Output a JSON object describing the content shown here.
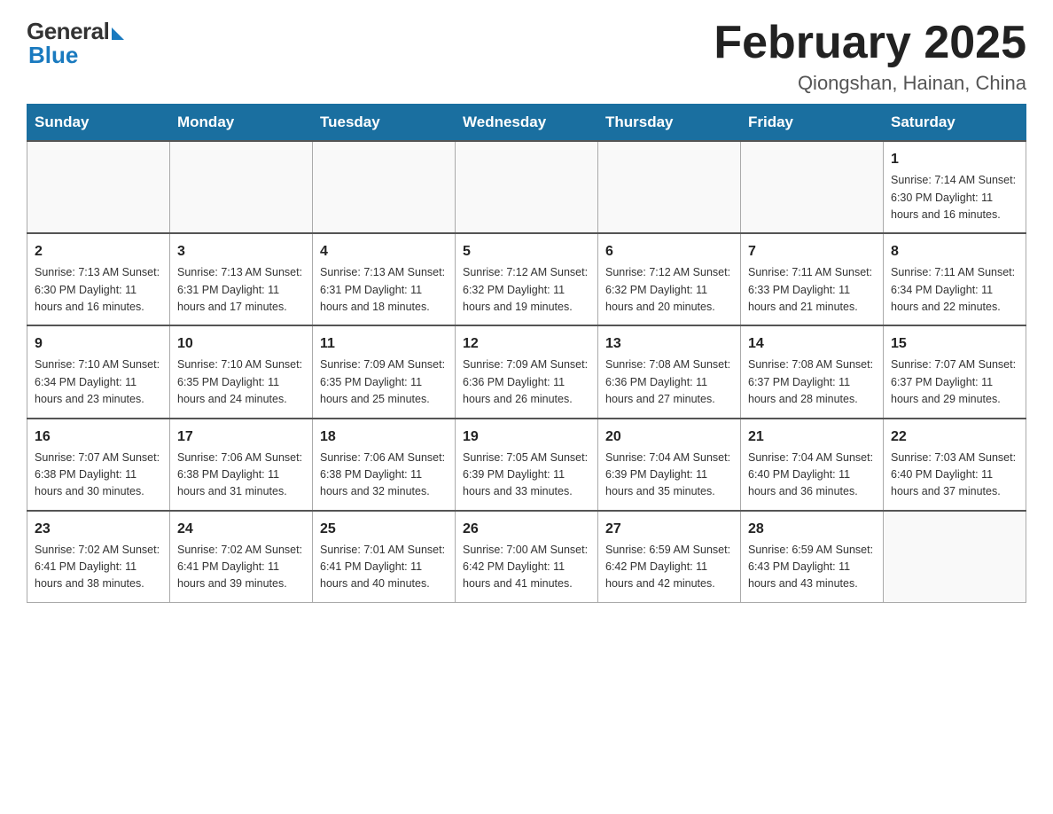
{
  "header": {
    "logo_general": "General",
    "logo_blue": "Blue",
    "month_title": "February 2025",
    "location": "Qiongshan, Hainan, China"
  },
  "weekdays": [
    "Sunday",
    "Monday",
    "Tuesday",
    "Wednesday",
    "Thursday",
    "Friday",
    "Saturday"
  ],
  "weeks": [
    [
      {
        "day": "",
        "info": ""
      },
      {
        "day": "",
        "info": ""
      },
      {
        "day": "",
        "info": ""
      },
      {
        "day": "",
        "info": ""
      },
      {
        "day": "",
        "info": ""
      },
      {
        "day": "",
        "info": ""
      },
      {
        "day": "1",
        "info": "Sunrise: 7:14 AM\nSunset: 6:30 PM\nDaylight: 11 hours\nand 16 minutes."
      }
    ],
    [
      {
        "day": "2",
        "info": "Sunrise: 7:13 AM\nSunset: 6:30 PM\nDaylight: 11 hours\nand 16 minutes."
      },
      {
        "day": "3",
        "info": "Sunrise: 7:13 AM\nSunset: 6:31 PM\nDaylight: 11 hours\nand 17 minutes."
      },
      {
        "day": "4",
        "info": "Sunrise: 7:13 AM\nSunset: 6:31 PM\nDaylight: 11 hours\nand 18 minutes."
      },
      {
        "day": "5",
        "info": "Sunrise: 7:12 AM\nSunset: 6:32 PM\nDaylight: 11 hours\nand 19 minutes."
      },
      {
        "day": "6",
        "info": "Sunrise: 7:12 AM\nSunset: 6:32 PM\nDaylight: 11 hours\nand 20 minutes."
      },
      {
        "day": "7",
        "info": "Sunrise: 7:11 AM\nSunset: 6:33 PM\nDaylight: 11 hours\nand 21 minutes."
      },
      {
        "day": "8",
        "info": "Sunrise: 7:11 AM\nSunset: 6:34 PM\nDaylight: 11 hours\nand 22 minutes."
      }
    ],
    [
      {
        "day": "9",
        "info": "Sunrise: 7:10 AM\nSunset: 6:34 PM\nDaylight: 11 hours\nand 23 minutes."
      },
      {
        "day": "10",
        "info": "Sunrise: 7:10 AM\nSunset: 6:35 PM\nDaylight: 11 hours\nand 24 minutes."
      },
      {
        "day": "11",
        "info": "Sunrise: 7:09 AM\nSunset: 6:35 PM\nDaylight: 11 hours\nand 25 minutes."
      },
      {
        "day": "12",
        "info": "Sunrise: 7:09 AM\nSunset: 6:36 PM\nDaylight: 11 hours\nand 26 minutes."
      },
      {
        "day": "13",
        "info": "Sunrise: 7:08 AM\nSunset: 6:36 PM\nDaylight: 11 hours\nand 27 minutes."
      },
      {
        "day": "14",
        "info": "Sunrise: 7:08 AM\nSunset: 6:37 PM\nDaylight: 11 hours\nand 28 minutes."
      },
      {
        "day": "15",
        "info": "Sunrise: 7:07 AM\nSunset: 6:37 PM\nDaylight: 11 hours\nand 29 minutes."
      }
    ],
    [
      {
        "day": "16",
        "info": "Sunrise: 7:07 AM\nSunset: 6:38 PM\nDaylight: 11 hours\nand 30 minutes."
      },
      {
        "day": "17",
        "info": "Sunrise: 7:06 AM\nSunset: 6:38 PM\nDaylight: 11 hours\nand 31 minutes."
      },
      {
        "day": "18",
        "info": "Sunrise: 7:06 AM\nSunset: 6:38 PM\nDaylight: 11 hours\nand 32 minutes."
      },
      {
        "day": "19",
        "info": "Sunrise: 7:05 AM\nSunset: 6:39 PM\nDaylight: 11 hours\nand 33 minutes."
      },
      {
        "day": "20",
        "info": "Sunrise: 7:04 AM\nSunset: 6:39 PM\nDaylight: 11 hours\nand 35 minutes."
      },
      {
        "day": "21",
        "info": "Sunrise: 7:04 AM\nSunset: 6:40 PM\nDaylight: 11 hours\nand 36 minutes."
      },
      {
        "day": "22",
        "info": "Sunrise: 7:03 AM\nSunset: 6:40 PM\nDaylight: 11 hours\nand 37 minutes."
      }
    ],
    [
      {
        "day": "23",
        "info": "Sunrise: 7:02 AM\nSunset: 6:41 PM\nDaylight: 11 hours\nand 38 minutes."
      },
      {
        "day": "24",
        "info": "Sunrise: 7:02 AM\nSunset: 6:41 PM\nDaylight: 11 hours\nand 39 minutes."
      },
      {
        "day": "25",
        "info": "Sunrise: 7:01 AM\nSunset: 6:41 PM\nDaylight: 11 hours\nand 40 minutes."
      },
      {
        "day": "26",
        "info": "Sunrise: 7:00 AM\nSunset: 6:42 PM\nDaylight: 11 hours\nand 41 minutes."
      },
      {
        "day": "27",
        "info": "Sunrise: 6:59 AM\nSunset: 6:42 PM\nDaylight: 11 hours\nand 42 minutes."
      },
      {
        "day": "28",
        "info": "Sunrise: 6:59 AM\nSunset: 6:43 PM\nDaylight: 11 hours\nand 43 minutes."
      },
      {
        "day": "",
        "info": ""
      }
    ]
  ]
}
